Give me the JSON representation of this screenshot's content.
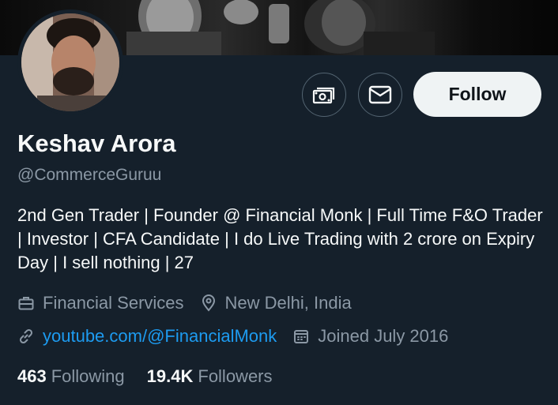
{
  "profile": {
    "name": "Keshav Arora",
    "handle": "@CommerceGuruu",
    "bio": "2nd Gen Trader | Founder @ Financial Monk | Full Time F&O Trader | Investor | CFA Candidate | I do Live Trading with 2 crore on Expiry Day | I sell nothing | 27",
    "category": "Financial Services",
    "location": "New Delhi, India",
    "website": "youtube.com/@FinancialMonk",
    "joined": "Joined July 2016"
  },
  "stats": {
    "following_count": "463",
    "following_label": "Following",
    "followers_count": "19.4K",
    "followers_label": "Followers"
  },
  "actions": {
    "follow_label": "Follow"
  },
  "icons": {
    "tip": "money-icon",
    "message": "envelope-icon",
    "category": "briefcase-icon",
    "location": "location-pin-icon",
    "website": "link-icon",
    "joined": "calendar-icon"
  },
  "colors": {
    "background": "#15202b",
    "accent_link": "#1d9bf0",
    "secondary_text": "#8b98a5",
    "follow_button_bg": "#eff3f4"
  }
}
